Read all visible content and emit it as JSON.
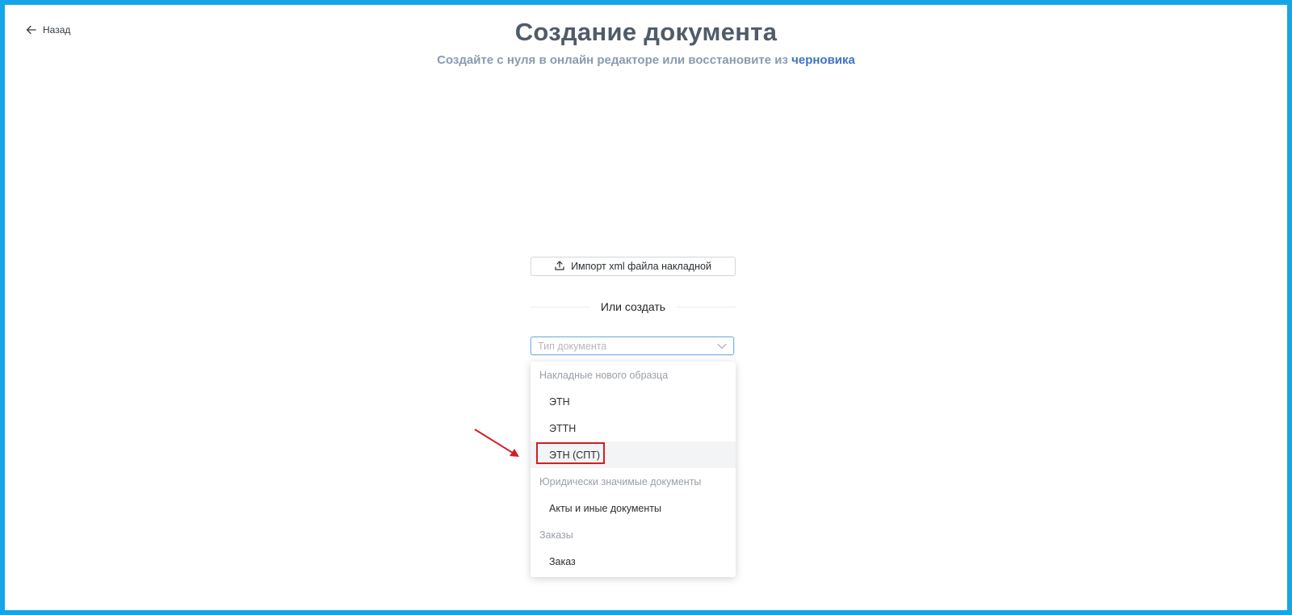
{
  "nav": {
    "back_label": "Назад"
  },
  "header": {
    "title": "Создание документа",
    "subtitle_prefix": "Создайте с нуля в онлайн редакторе или восстановите из",
    "subtitle_link": "черновика"
  },
  "import": {
    "label": "Импорт xml файла накладной",
    "icon": "upload-icon"
  },
  "divider": {
    "label": "Или создать"
  },
  "doc_type_select": {
    "placeholder": "Тип документа",
    "icon": "chevron-down-icon"
  },
  "dropdown": {
    "groups": [
      {
        "label": "Накладные нового образца",
        "options": [
          "ЭТН",
          "ЭТТН",
          "ЭТН (СПТ)"
        ]
      },
      {
        "label": "Юридически значимые документы",
        "options": [
          "Акты и иные документы"
        ]
      },
      {
        "label": "Заказы",
        "options": [
          "Заказ"
        ]
      }
    ],
    "highlighted_option": "ЭТН (СПТ)"
  },
  "colors": {
    "frame_border": "#16a6e8",
    "link": "#3b73c4",
    "annotation": "#d11f25"
  }
}
